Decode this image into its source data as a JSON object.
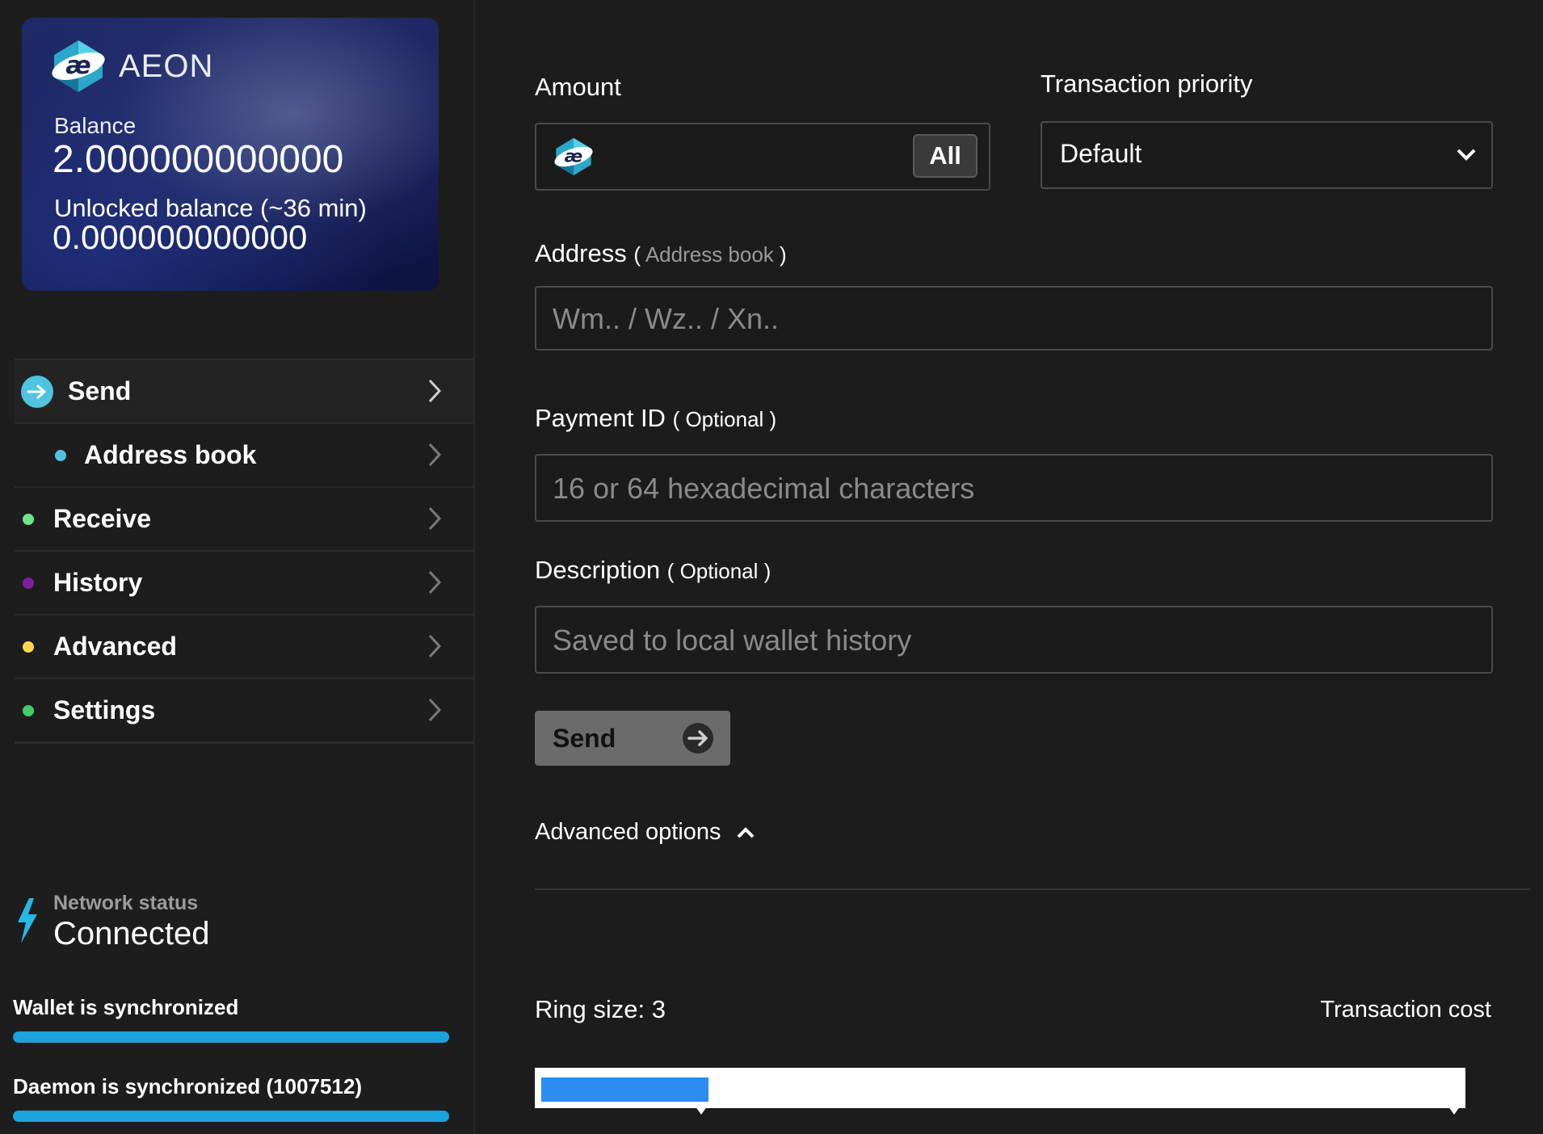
{
  "card": {
    "brand": "AEON",
    "balance_label": "Balance",
    "balance": "2.000000000000",
    "unlocked_label": "Unlocked balance (~36 min)",
    "unlocked": "0.000000000000"
  },
  "nav": {
    "send": "Send",
    "address_book": "Address book",
    "receive": "Receive",
    "history": "History",
    "advanced": "Advanced",
    "settings": "Settings"
  },
  "colors": {
    "send": "#4fc3e0",
    "address_book": "#4fc3e0",
    "receive": "#6ee68c",
    "history": "#7b1fa2",
    "advanced": "#ffd54f",
    "settings": "#3ecf6a",
    "sync_bar": "#1aa3dc"
  },
  "network": {
    "label": "Network status",
    "value": "Connected"
  },
  "sync": {
    "wallet": "Wallet is synchronized",
    "wallet_progress": 1.0,
    "daemon": "Daemon is synchronized (1007512)",
    "daemon_progress": 1.0
  },
  "form": {
    "amount_label": "Amount",
    "all_button": "All",
    "priority_label": "Transaction priority",
    "priority_value": "Default",
    "address_label": "Address",
    "address_book_open": "( ",
    "address_book_link": "Address book",
    "address_book_close": " )",
    "address_placeholder": "Wm.. / Wz.. / Xn..",
    "payment_id_label": "Payment ID",
    "payment_id_hint": "( Optional )",
    "payment_id_placeholder": "16 or 64 hexadecimal characters",
    "description_label": "Description",
    "description_hint": "( Optional )",
    "description_placeholder": "Saved to local wallet history",
    "send_button": "Send",
    "advanced_options": "Advanced options",
    "ring_size": "Ring size: 3",
    "transaction_cost": "Transaction cost",
    "transaction_cost_level": 0.18
  }
}
